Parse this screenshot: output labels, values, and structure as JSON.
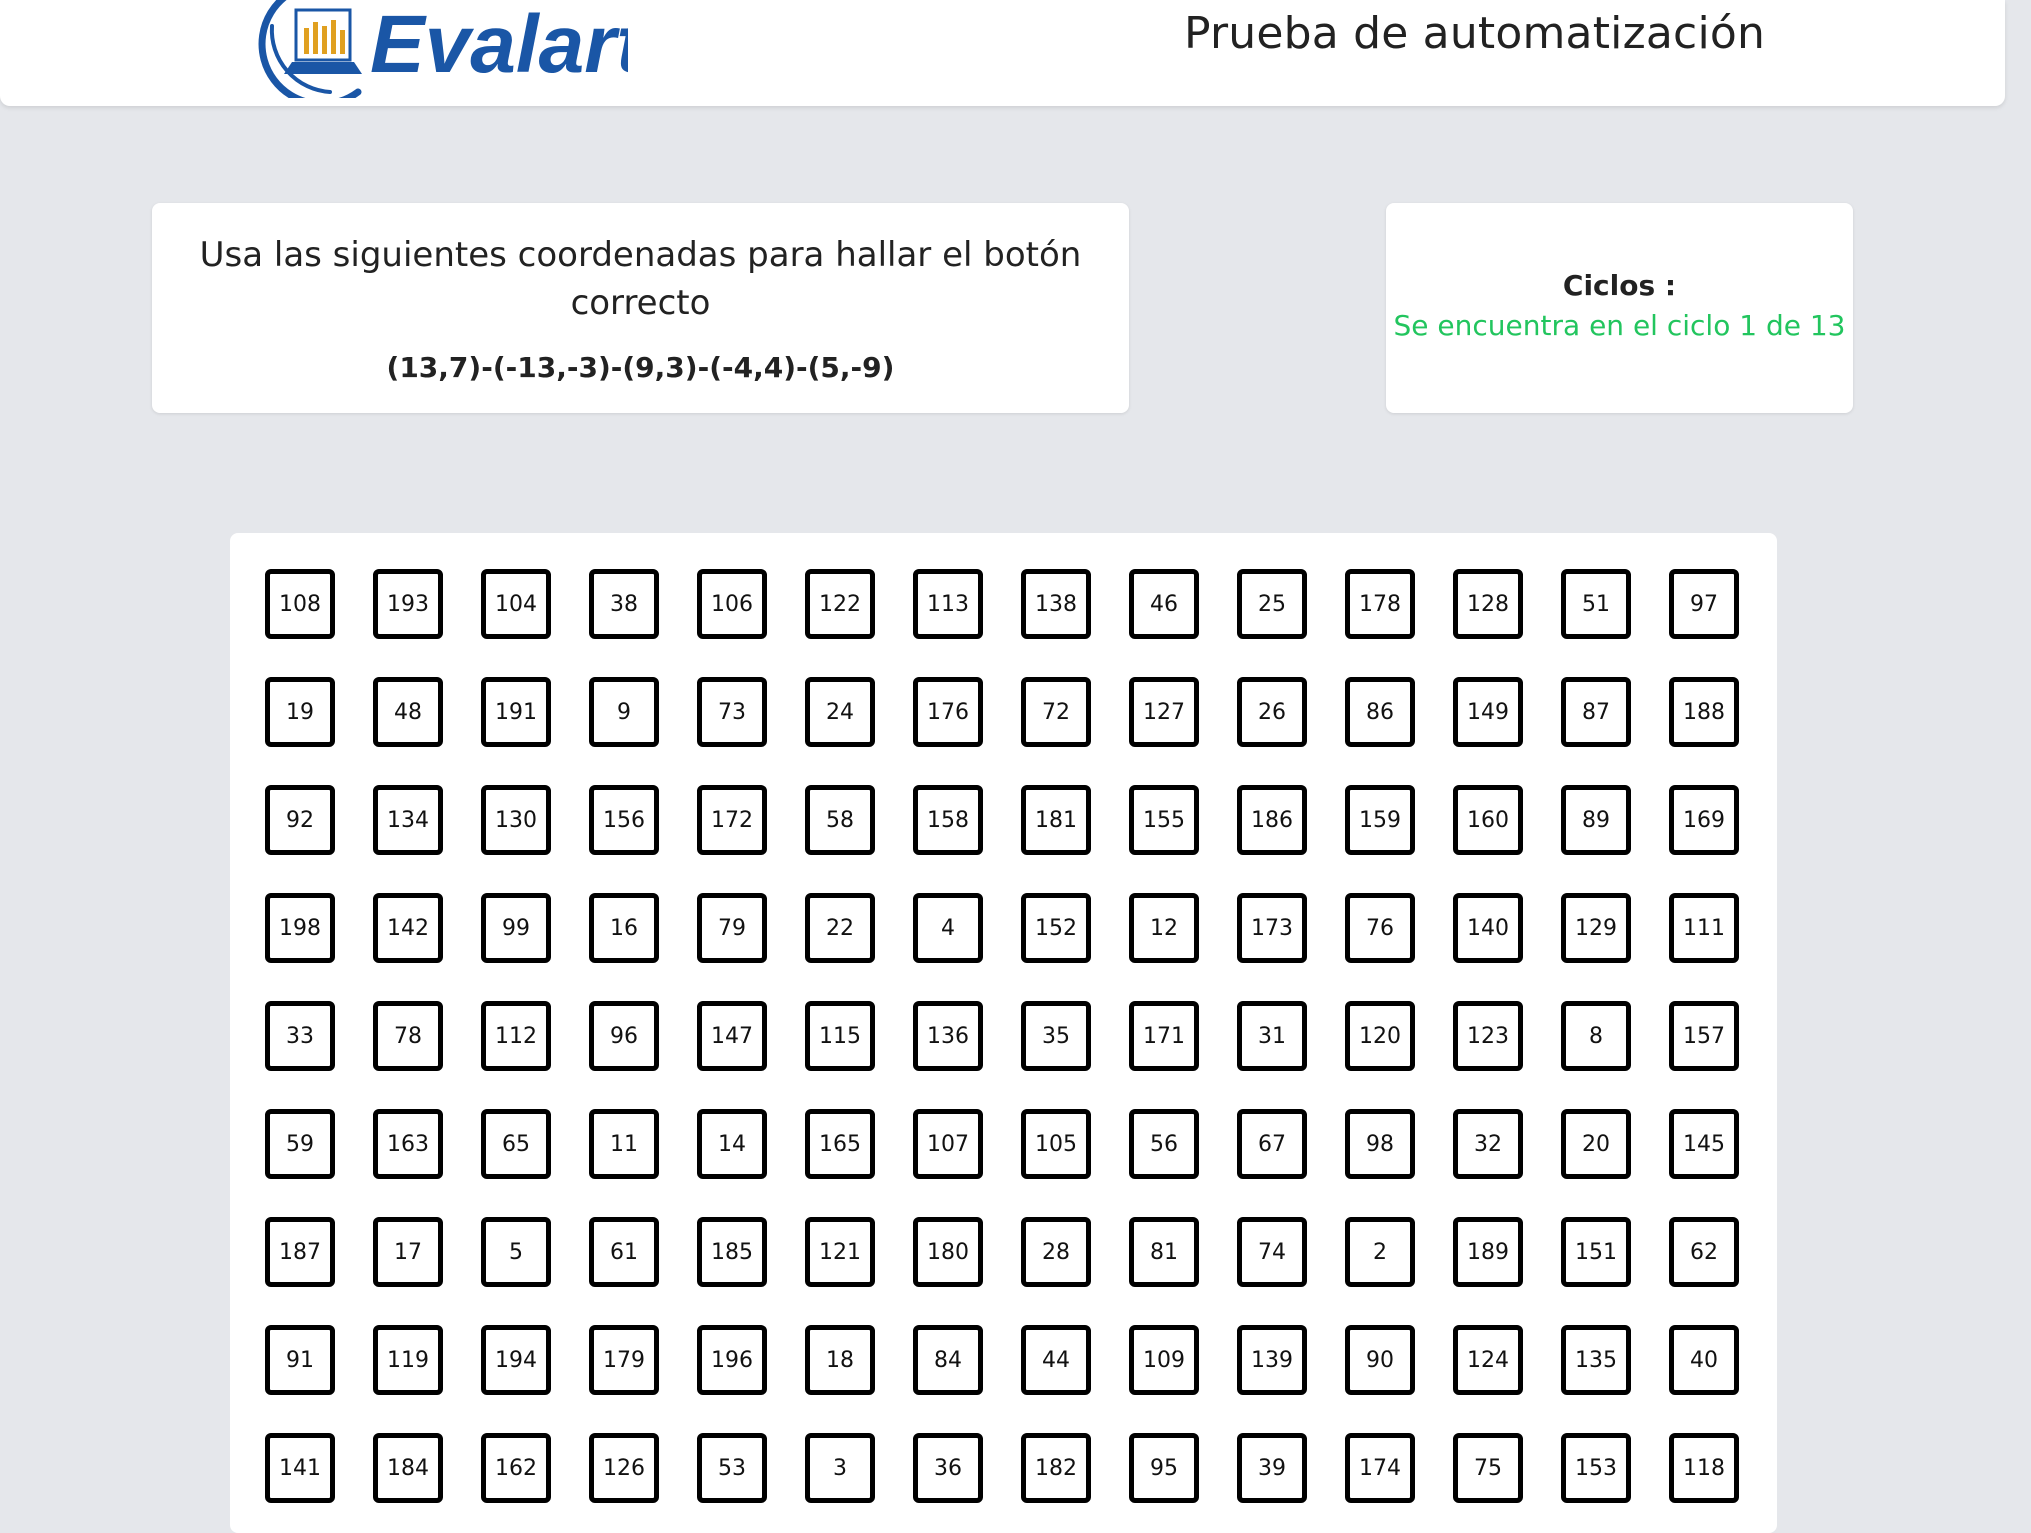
{
  "header": {
    "logo_text": "Evalart",
    "title": "Prueba de automatización"
  },
  "instructions": {
    "text": "Usa las siguientes coordenadas para hallar el botón correcto",
    "coordinates": "(13,7)-(-13,-3)-(9,3)-(-4,4)-(5,-9)"
  },
  "cycles": {
    "label": "Ciclos :",
    "value": "Se encuentra en el ciclo 1 de 13"
  },
  "colors": {
    "background": "#e5e7eb",
    "logo_blue": "#1a56a6",
    "cycle_green": "#22c55e",
    "button_border": "#000000"
  },
  "grid": {
    "rows": [
      [
        "108",
        "193",
        "104",
        "38",
        "106",
        "122",
        "113",
        "138",
        "46",
        "25",
        "178",
        "128",
        "51",
        "97"
      ],
      [
        "19",
        "48",
        "191",
        "9",
        "73",
        "24",
        "176",
        "72",
        "127",
        "26",
        "86",
        "149",
        "87",
        "188"
      ],
      [
        "92",
        "134",
        "130",
        "156",
        "172",
        "58",
        "158",
        "181",
        "155",
        "186",
        "159",
        "160",
        "89",
        "169"
      ],
      [
        "198",
        "142",
        "99",
        "16",
        "79",
        "22",
        "4",
        "152",
        "12",
        "173",
        "76",
        "140",
        "129",
        "111"
      ],
      [
        "33",
        "78",
        "112",
        "96",
        "147",
        "115",
        "136",
        "35",
        "171",
        "31",
        "120",
        "123",
        "8",
        "157"
      ],
      [
        "59",
        "163",
        "65",
        "11",
        "14",
        "165",
        "107",
        "105",
        "56",
        "67",
        "98",
        "32",
        "20",
        "145"
      ],
      [
        "187",
        "17",
        "5",
        "61",
        "185",
        "121",
        "180",
        "28",
        "81",
        "74",
        "2",
        "189",
        "151",
        "62"
      ],
      [
        "91",
        "119",
        "194",
        "179",
        "196",
        "18",
        "84",
        "44",
        "109",
        "139",
        "90",
        "124",
        "135",
        "40"
      ],
      [
        "141",
        "184",
        "162",
        "126",
        "53",
        "3",
        "36",
        "182",
        "95",
        "39",
        "174",
        "75",
        "153",
        "118"
      ]
    ]
  }
}
